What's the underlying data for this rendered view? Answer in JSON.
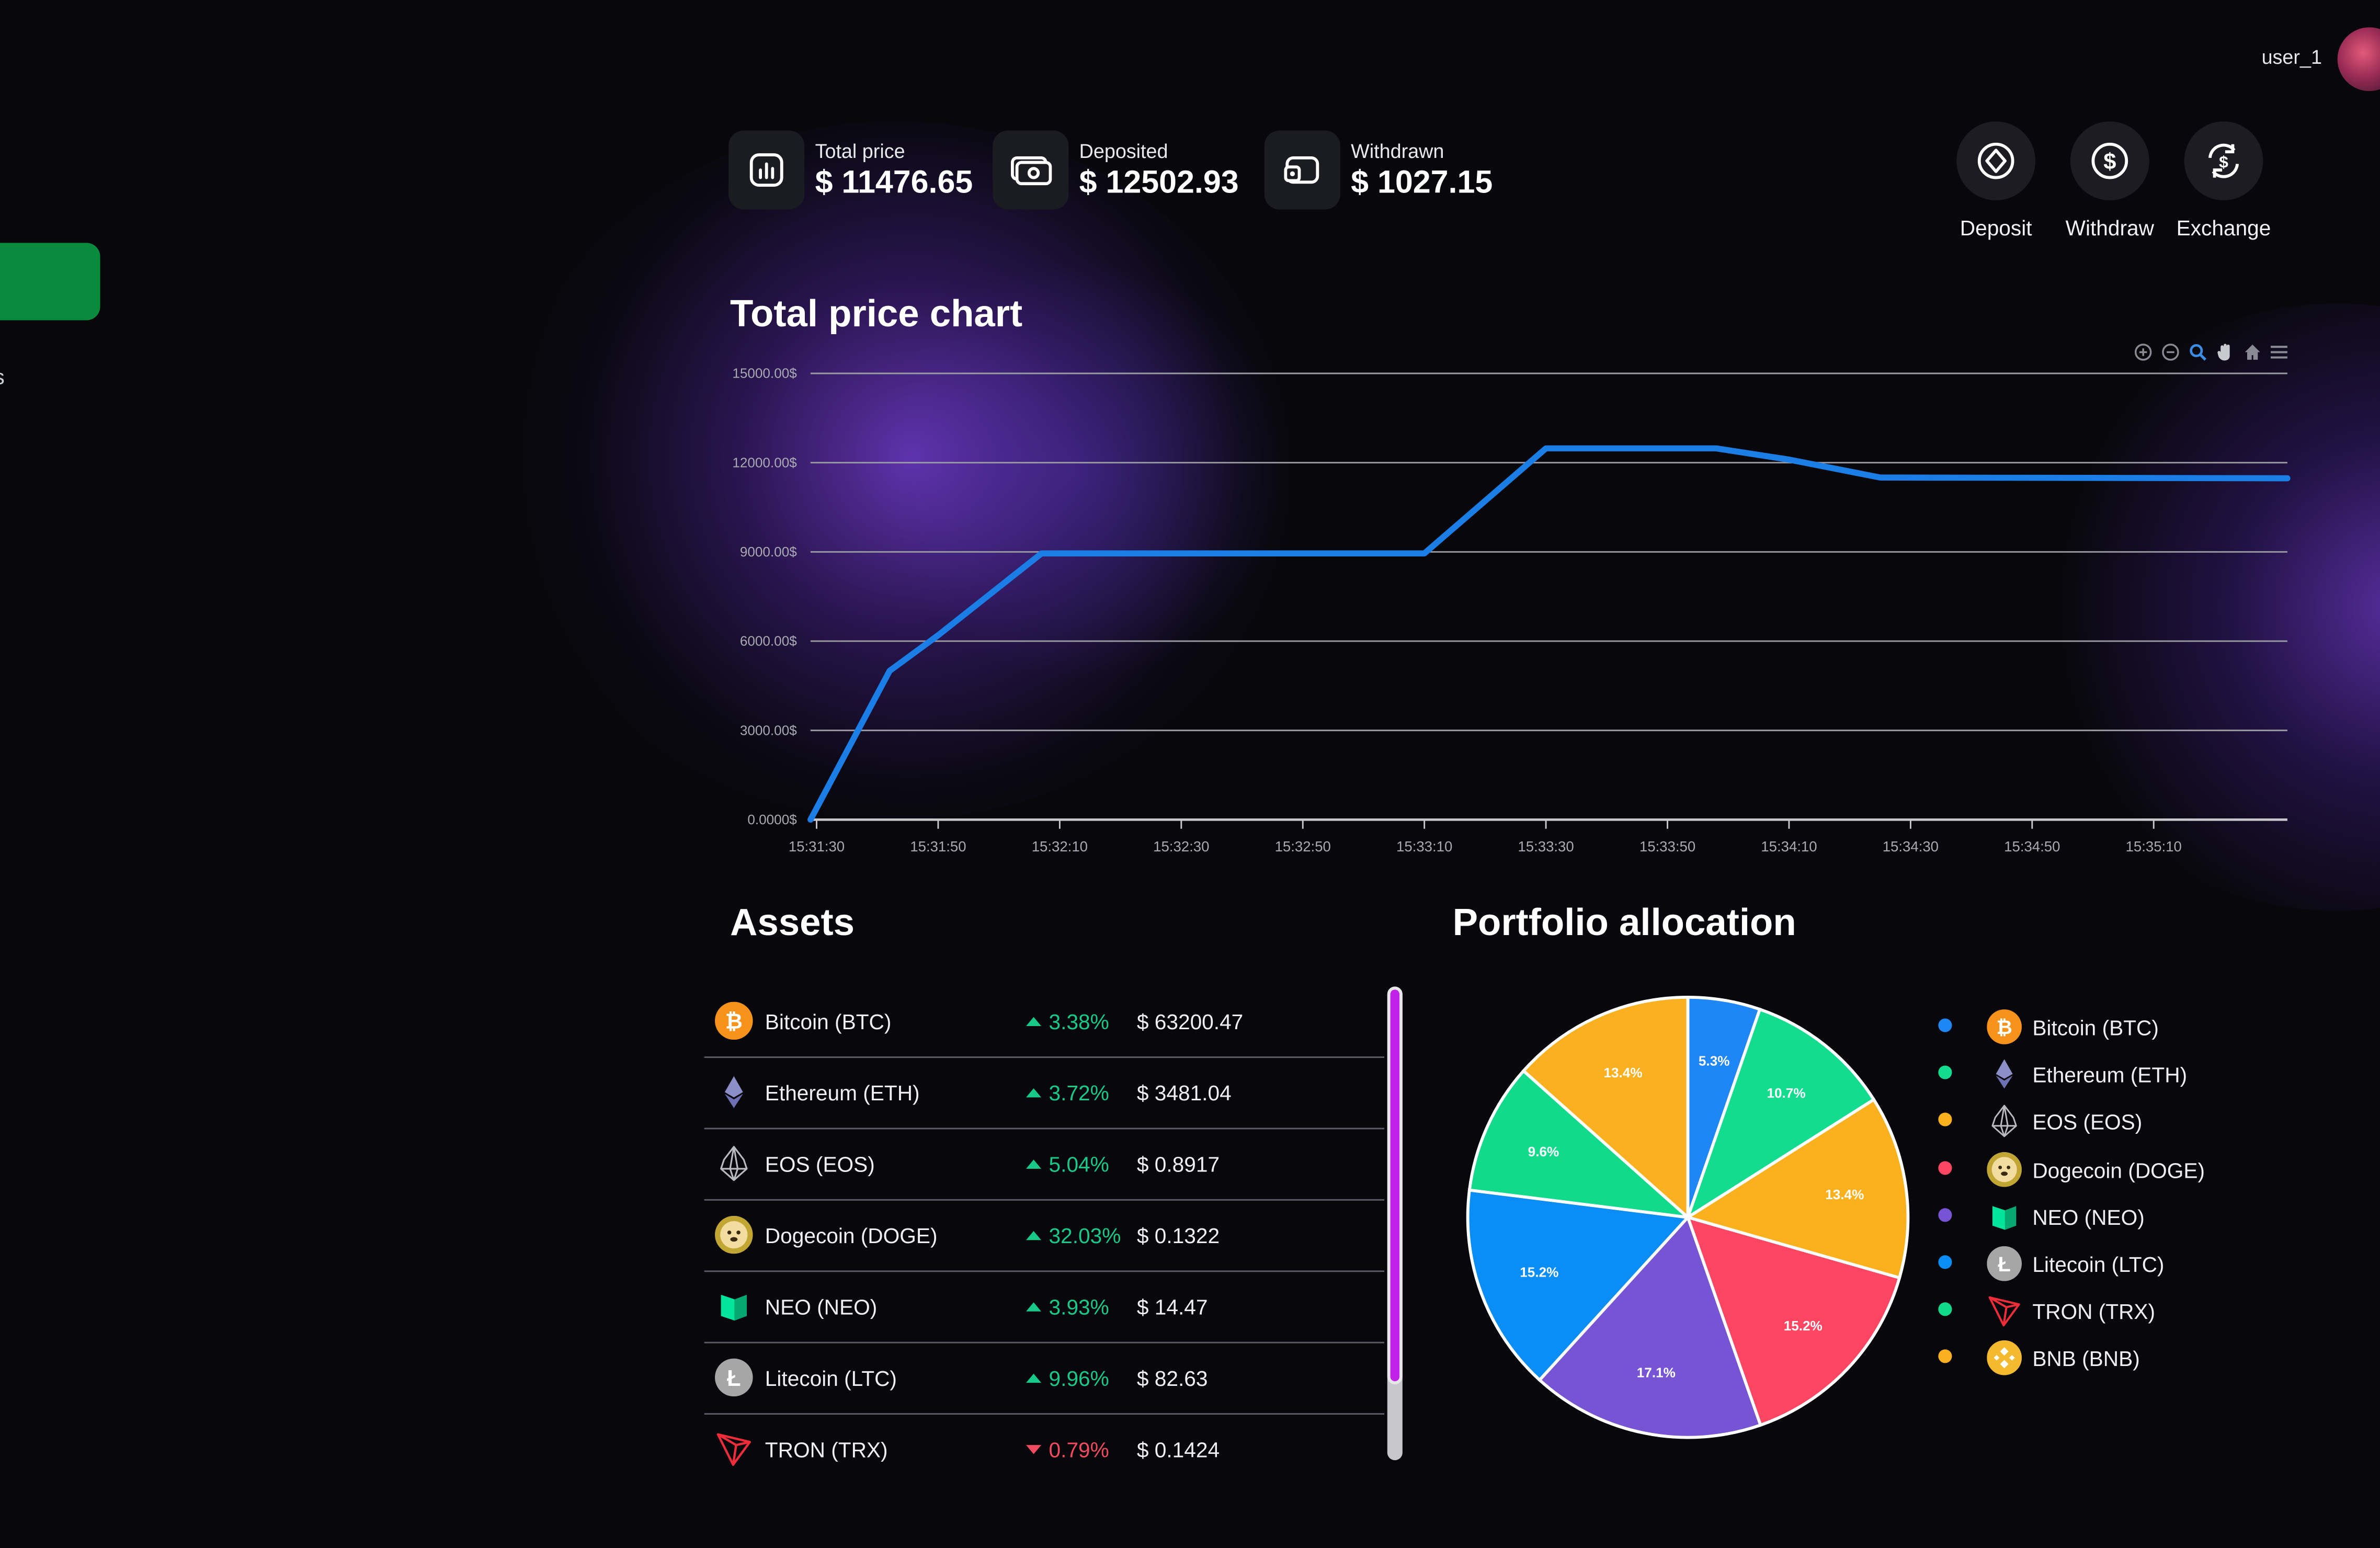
{
  "header": {
    "username": "user_1"
  },
  "stats": [
    {
      "label": "Total price",
      "value": "$ 11476.65",
      "icon": "chart-icon"
    },
    {
      "label": "Deposited",
      "value": "$ 12502.93",
      "icon": "banknote-icon"
    },
    {
      "label": "Withdrawn",
      "value": "$ 1027.15",
      "icon": "wallet-icon"
    }
  ],
  "actions": [
    {
      "label": "Deposit",
      "icon": "deposit-icon"
    },
    {
      "label": "Withdraw",
      "icon": "withdraw-icon"
    },
    {
      "label": "Exchange",
      "icon": "exchange-icon"
    }
  ],
  "sidebar": {
    "fragment": "s"
  },
  "chart_section": {
    "title": "Total price chart",
    "toolbar": [
      "zoom-in-icon",
      "zoom-out-icon",
      "zoom-select-icon",
      "pan-icon",
      "reset-home-icon",
      "menu-icon"
    ]
  },
  "chart_data": {
    "type": "line",
    "title": "Total price chart",
    "xlabel": "",
    "ylabel": "",
    "x_tick_labels": [
      "15:31:30",
      "15:31:50",
      "15:32:10",
      "15:32:30",
      "15:32:50",
      "15:33:10",
      "15:33:30",
      "15:33:50",
      "15:34:10",
      "15:34:30",
      "15:34:50",
      "15:35:10"
    ],
    "y_tick_labels": [
      "0.0000$",
      "3000.00$",
      "6000.00$",
      "9000.00$",
      "12000.00$",
      "15000.00$"
    ],
    "ylim": [
      0,
      15000
    ],
    "xlim": [
      "15:31:29",
      "15:35:32"
    ],
    "grid": true,
    "series": [
      {
        "color": "#1a7ee6",
        "points": [
          {
            "x": "15:31:29",
            "y": 0
          },
          {
            "x": "15:31:42",
            "y": 5000
          },
          {
            "x": "15:31:50",
            "y": 6200
          },
          {
            "x": "15:32:07",
            "y": 8950
          },
          {
            "x": "15:33:10",
            "y": 8950
          },
          {
            "x": "15:33:30",
            "y": 12480
          },
          {
            "x": "15:33:58",
            "y": 12480
          },
          {
            "x": "15:34:10",
            "y": 12100
          },
          {
            "x": "15:34:25",
            "y": 11500
          },
          {
            "x": "15:35:32",
            "y": 11476.65
          }
        ]
      }
    ]
  },
  "assets": {
    "title": "Assets",
    "rows": [
      {
        "name": "Bitcoin (BTC)",
        "change": "3.38%",
        "direction": "up",
        "price": "$ 63200.47",
        "icon": "bitcoin-icon"
      },
      {
        "name": "Ethereum (ETH)",
        "change": "3.72%",
        "direction": "up",
        "price": "$ 3481.04",
        "icon": "ethereum-icon"
      },
      {
        "name": "EOS (EOS)",
        "change": "5.04%",
        "direction": "up",
        "price": "$ 0.8917",
        "icon": "eos-icon"
      },
      {
        "name": "Dogecoin (DOGE)",
        "change": "32.03%",
        "direction": "up",
        "price": "$ 0.1322",
        "icon": "dogecoin-icon"
      },
      {
        "name": "NEO (NEO)",
        "change": "3.93%",
        "direction": "up",
        "price": "$ 14.47",
        "icon": "neo-icon"
      },
      {
        "name": "Litecoin (LTC)",
        "change": "9.96%",
        "direction": "up",
        "price": "$ 82.63",
        "icon": "litecoin-icon"
      },
      {
        "name": "TRON (TRX)",
        "change": "0.79%",
        "direction": "down",
        "price": "$ 0.1424",
        "icon": "tron-icon"
      }
    ],
    "scroll_position": 0.84
  },
  "portfolio": {
    "title": "Portfolio allocation",
    "slices": [
      {
        "value": 5.3,
        "label": "5.3%",
        "color": "#1f86f5"
      },
      {
        "value": 10.7,
        "label": "10.7%",
        "color": "#12dc8e"
      },
      {
        "value": 13.4,
        "label": "13.4%",
        "color": "#fbb11e"
      },
      {
        "value": 15.2,
        "label": "15.2%",
        "color": "#fe4561"
      },
      {
        "value": 17.1,
        "label": "17.1%",
        "color": "#7654d3"
      },
      {
        "value": 15.2,
        "label": "15.2%",
        "color": "#0a8df4"
      },
      {
        "value": 9.6,
        "label": "9.6%",
        "color": "#11da8a"
      },
      {
        "value": 13.4,
        "label": "13.4%",
        "color": "#fbb020"
      }
    ],
    "legend": [
      {
        "name": "Bitcoin (BTC)",
        "dot": "#1f86f5",
        "icon": "bitcoin-icon"
      },
      {
        "name": "Ethereum (ETH)",
        "dot": "#12dc8e",
        "icon": "ethereum-icon"
      },
      {
        "name": "EOS (EOS)",
        "dot": "#fbb11e",
        "icon": "eos-icon"
      },
      {
        "name": "Dogecoin (DOGE)",
        "dot": "#fe4561",
        "icon": "dogecoin-icon"
      },
      {
        "name": "NEO (NEO)",
        "dot": "#7654d3",
        "icon": "neo-icon"
      },
      {
        "name": "Litecoin (LTC)",
        "dot": "#0a8df4",
        "icon": "litecoin-icon"
      },
      {
        "name": "TRON (TRX)",
        "dot": "#11da8a",
        "icon": "tron-icon"
      },
      {
        "name": "BNB (BNB)",
        "dot": "#fbb020",
        "icon": "bnb-icon"
      }
    ]
  },
  "colors": {
    "background": "#08080c",
    "accent_green": "#0a8a3c",
    "line": "#1a7ee6",
    "up": "#19c98a",
    "down": "#f24a5e",
    "scroll_thumb": "#c221e8"
  }
}
